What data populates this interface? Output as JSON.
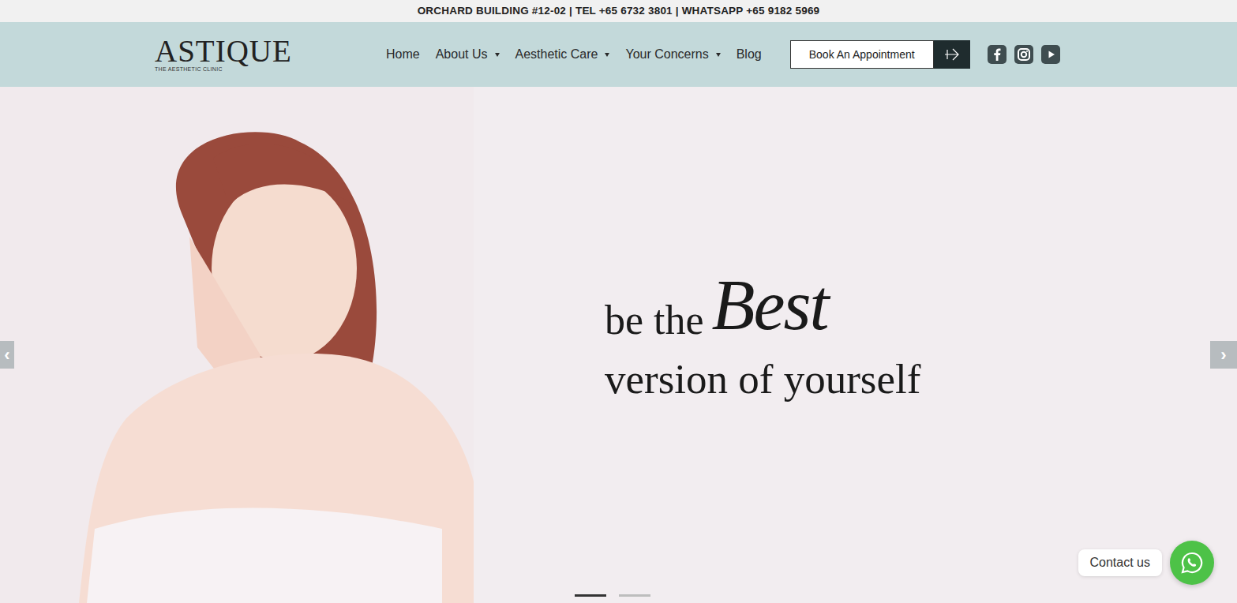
{
  "top_bar": {
    "text": "ORCHARD BUILDING #12-02 | TEL +65 6732 3801 | WHATSAPP +65 9182 5969"
  },
  "logo": {
    "name": "ASTIQUE",
    "tagline": "THE AESTHETIC CLINIC"
  },
  "nav": {
    "items": [
      {
        "label": "Home",
        "kind": "link"
      },
      {
        "label": "About Us",
        "kind": "dropdown"
      },
      {
        "label": "Aesthetic Care",
        "kind": "dropdown"
      },
      {
        "label": "Your Concerns",
        "kind": "dropdown"
      },
      {
        "label": "Blog",
        "kind": "link"
      }
    ]
  },
  "book_button": {
    "label": "Book An Appointment"
  },
  "social": [
    {
      "kind": "facebook"
    },
    {
      "kind": "instagram"
    },
    {
      "kind": "youtube"
    }
  ],
  "hero": {
    "line1": "be the",
    "accent": "Best",
    "line2": "version of yourself"
  },
  "carousel": {
    "prev": "‹",
    "next": "›",
    "indicators": [
      {
        "selected": true
      },
      {
        "selected": false
      }
    ]
  },
  "chat": {
    "label": "Contact us"
  }
}
